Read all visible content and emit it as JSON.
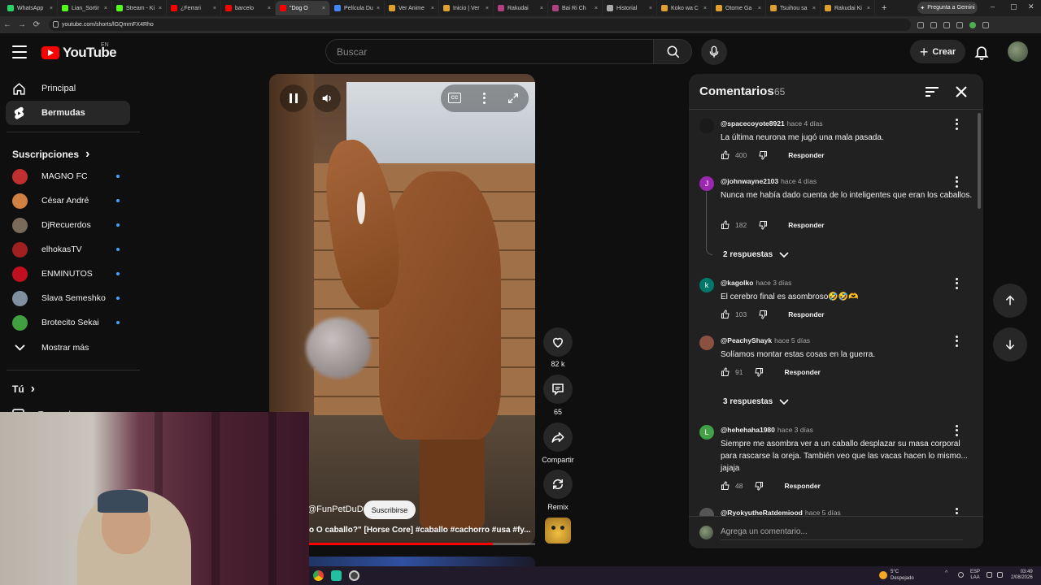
{
  "browser": {
    "tabs": [
      {
        "title": "WhatsApp",
        "color": "#25d366"
      },
      {
        "title": "Lian_Sortir",
        "color": "#53fc18"
      },
      {
        "title": "Stream - Ki",
        "color": "#53fc18"
      },
      {
        "title": "¿Ferrari",
        "color": "#ff0000"
      },
      {
        "title": "barcelo",
        "color": "#ff0000"
      },
      {
        "title": "\"Dog O",
        "color": "#ff0000",
        "active": true
      },
      {
        "title": "Película Du",
        "color": "#4285f4"
      },
      {
        "title": "Ver Anime",
        "color": "#e0a030"
      },
      {
        "title": "Inicio | Ver",
        "color": "#e0a030"
      },
      {
        "title": "Rakudai",
        "color": "#b04080"
      },
      {
        "title": "Bai Ri Ch",
        "color": "#b04080"
      },
      {
        "title": "Historial",
        "color": "#aaaaaa"
      },
      {
        "title": "Koko wa C",
        "color": "#e0a030"
      },
      {
        "title": "Otome Ga",
        "color": "#e0a030"
      },
      {
        "title": "Tsuihou sa",
        "color": "#e0a030"
      },
      {
        "title": "Rakudai Ki",
        "color": "#e0a030"
      }
    ],
    "tab_close": "×",
    "new_tab": "+",
    "gemini_label": "Pregunta a Gemini",
    "url": "youtube.com/shorts/lGQmmFX4Rho",
    "win_min": "–",
    "win_max": "▢",
    "win_close": "✕",
    "back": "←",
    "forward": "→",
    "reload": "⟳"
  },
  "header": {
    "logo_text": "YouTube",
    "country": "EN",
    "search_placeholder": "Buscar",
    "create_label": "Crear",
    "create_plus": "+"
  },
  "sidebar": {
    "main_items": [
      {
        "label": "Principal"
      },
      {
        "label": "Bermudas",
        "active": true
      }
    ],
    "subscriptions_title": "Suscripciones",
    "subscriptions": [
      {
        "label": "MAGNO FC",
        "color": "#c03030"
      },
      {
        "label": "César André",
        "color": "#d08040"
      },
      {
        "label": "DjRecuerdos",
        "color": "#7a6a5a"
      },
      {
        "label": "elhokasTV",
        "color": "#a02020"
      },
      {
        "label": "ENMINUTOS",
        "color": "#c01020"
      },
      {
        "label": "Slava Semeshko",
        "color": "#8090a0"
      },
      {
        "label": "Brotecito Sekai",
        "color": "#40a040"
      }
    ],
    "show_more": "Mostrar más",
    "you_title": "Tú",
    "your_channel": "Tu canal",
    "chevron": "›"
  },
  "video": {
    "channel": "@FunPetDuDu",
    "subscribe": "Suscribirse",
    "title": "o O caballo?\" [Horse Core] #caballo #cachorro #usa #fy...",
    "progress": 0.84,
    "cc_label": "CC"
  },
  "actions": {
    "likes": "82 k",
    "comments": "65",
    "share": "Compartir",
    "remix": "Remix"
  },
  "comments": {
    "title": "Comentarios",
    "count": "65",
    "reply_label": "Responder",
    "add_placeholder": "Agrega un comentario...",
    "items": [
      {
        "author": "@spacecoyote8921",
        "time": "hace 4 días",
        "text": "La última neurona me jugó una mala pasada.",
        "likes": "400",
        "avatar_letter": "",
        "avatar_color": "#1a1a1a"
      },
      {
        "author": "@johnwayne2103",
        "time": "hace 4 días",
        "text": "Nunca me había dado cuenta de lo inteligentes que eran los caballos.",
        "likes": "182",
        "avatar_letter": "J",
        "avatar_color": "#9c27b0",
        "replies": "2 respuestas"
      },
      {
        "author": "@kagolko",
        "time": "hace 3 días",
        "text": "El cerebro final es asombroso🤣🤣🫶",
        "likes": "103",
        "avatar_letter": "k",
        "avatar_color": "#00796b"
      },
      {
        "author": "@PeachyShayk",
        "time": "hace 5 días",
        "text": "Solíamos montar estas cosas en la guerra.",
        "likes": "91",
        "avatar_letter": "",
        "avatar_color": "#8a5040",
        "replies": "3 respuestas"
      },
      {
        "author": "@hehehaha1980",
        "time": "hace 3 días",
        "text": "Siempre me asombra ver a un caballo desplazar su masa corporal para rascarse la oreja. También veo que las vacas hacen lo mismo... jajaja",
        "likes": "48",
        "avatar_letter": "L",
        "avatar_color": "#43a047"
      },
      {
        "author": "@RyokyutheRatdemiood",
        "time": "hace 5 días",
        "text": "",
        "likes": "",
        "avatar_letter": "",
        "avatar_color": "#555555"
      }
    ]
  },
  "taskbar": {
    "temperature": "5°C",
    "weather": "Despejado",
    "lang_top": "ESP",
    "lang_bottom": "LAA",
    "time": "03:49",
    "date": "2/08/2026"
  },
  "colors": {
    "brand_red": "#ff0000",
    "link_blue": "#3ea6ff",
    "background": "#0f0f0f",
    "panel": "#212121"
  },
  "icons": [
    "menu-icon",
    "home-icon",
    "shorts-icon",
    "search-icon",
    "mic-icon",
    "bell-icon",
    "pause-icon",
    "volume-icon",
    "captions-icon",
    "fullscreen-icon",
    "like-icon",
    "dislike-icon",
    "comment-icon",
    "share-icon",
    "remix-icon",
    "sort-icon",
    "close-icon",
    "arrow-up-icon",
    "arrow-down-icon"
  ]
}
